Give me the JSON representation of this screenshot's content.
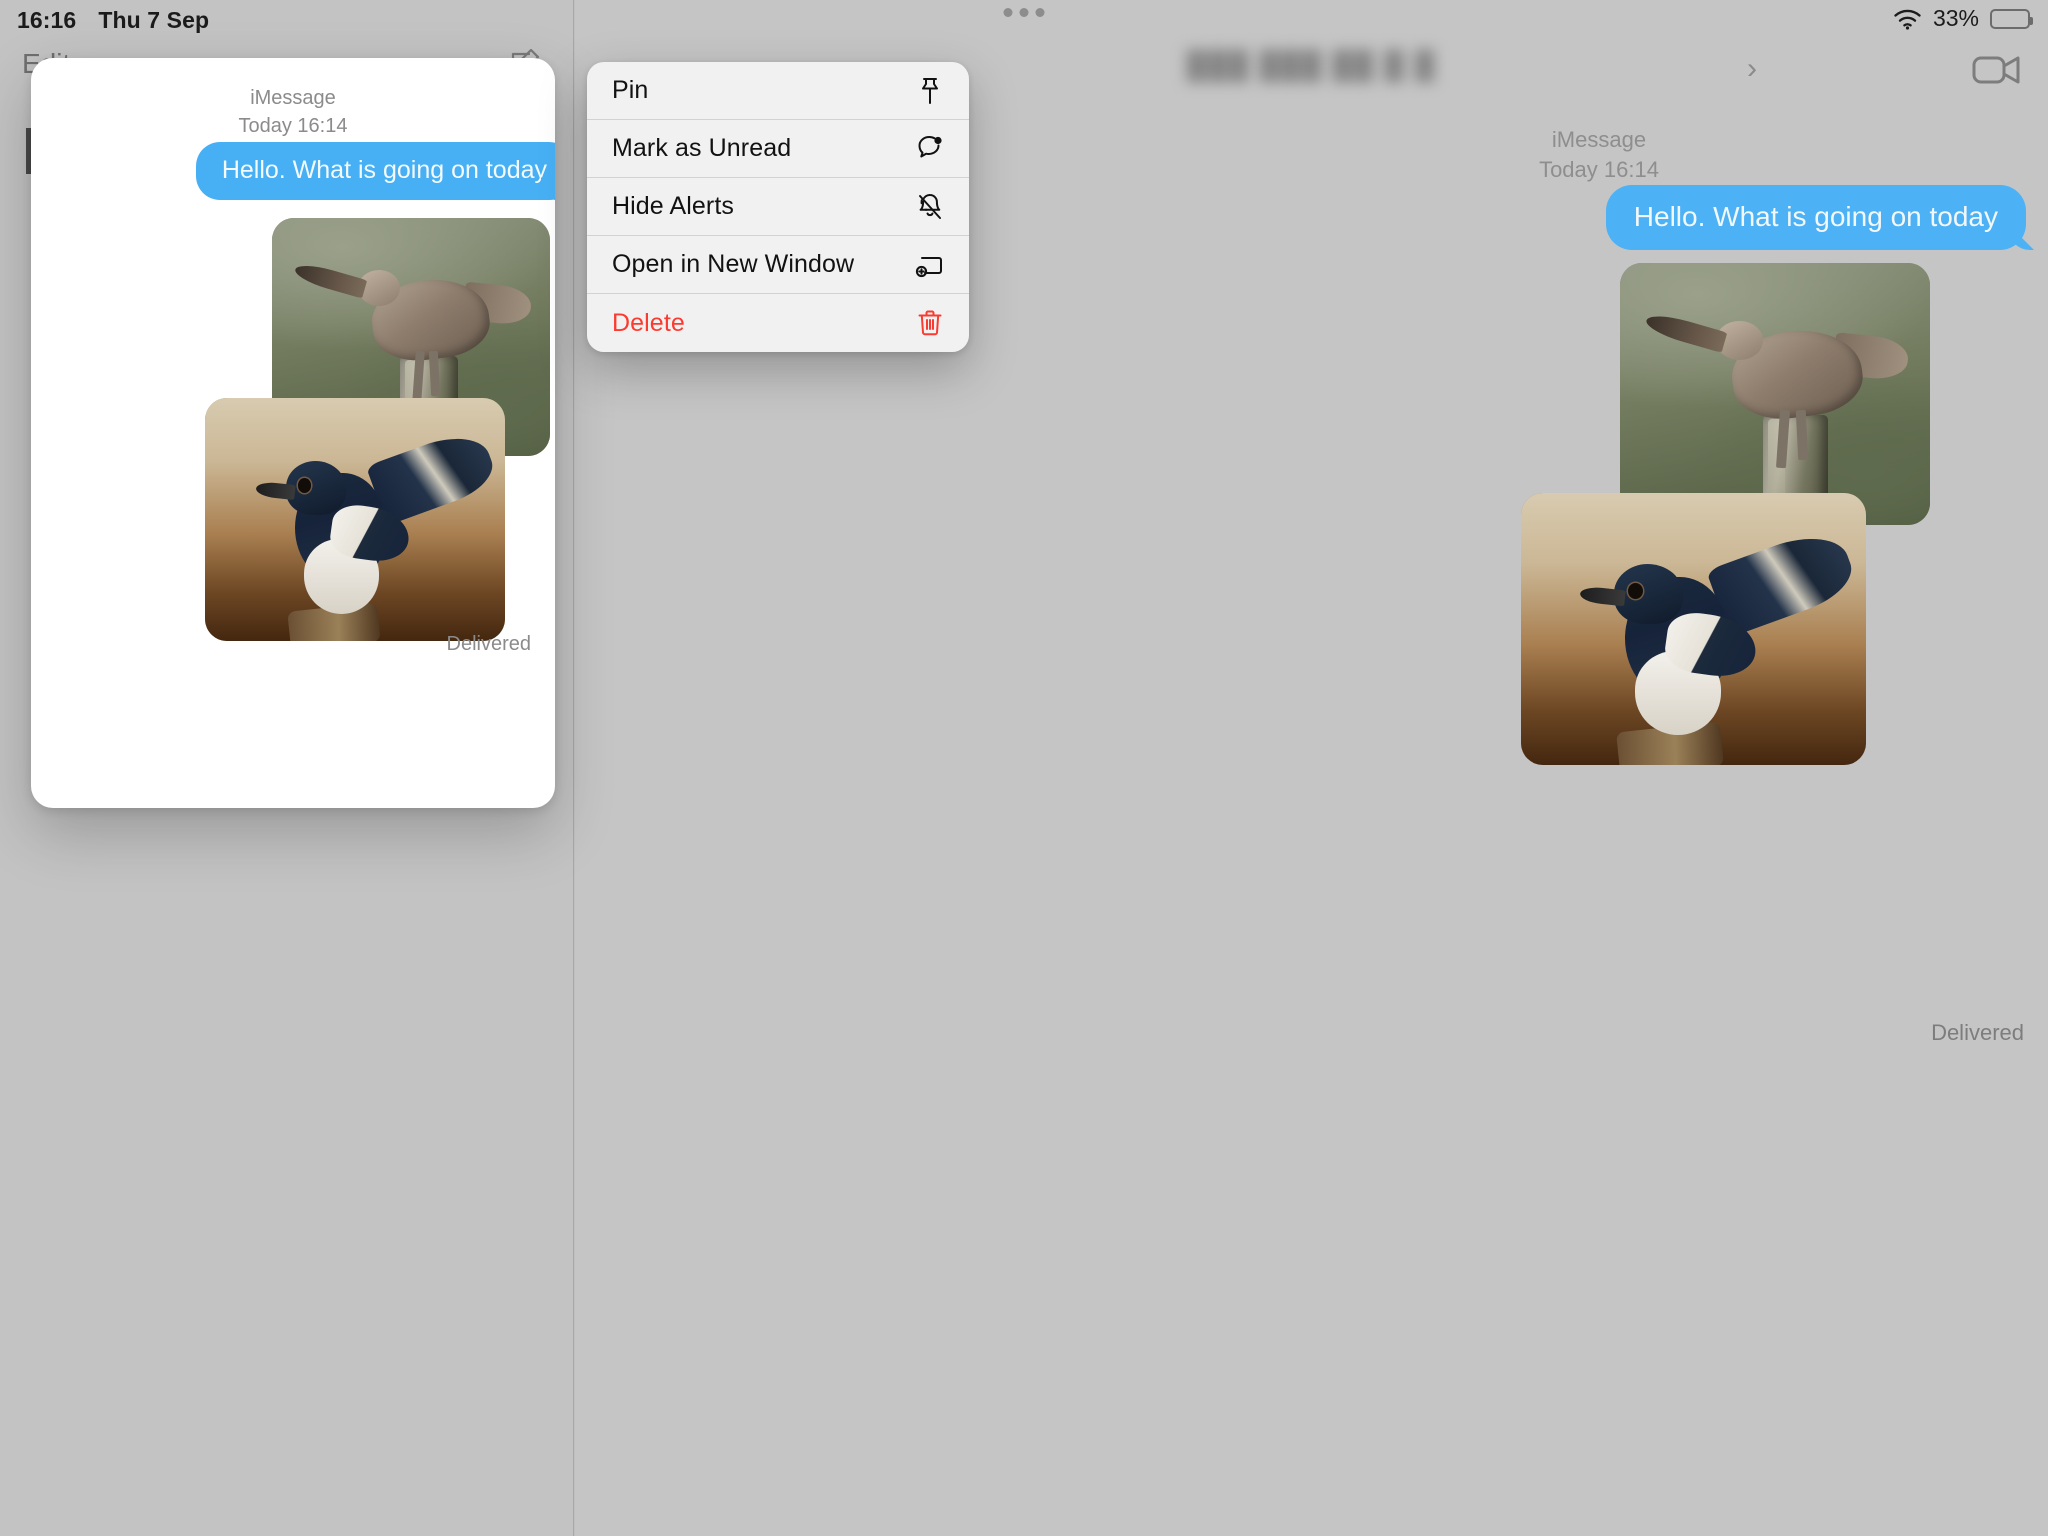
{
  "status_bar": {
    "time": "16:16",
    "date": "Thu 7 Sep",
    "wifi_icon": "wifi-icon",
    "battery_percent": "33%",
    "battery_level": 33
  },
  "multitask_handle": {
    "icon": "multitasking-dots-icon",
    "dot_count": 3
  },
  "sidebar": {
    "edit_label": "Edit",
    "compose_icon": "compose-icon"
  },
  "conversation_header": {
    "contact_name": "",
    "contact_name_redacted": true,
    "chevron_icon": "chevron-right-icon",
    "facetime_icon": "video-camera-icon"
  },
  "thread": {
    "service_label": "iMessage",
    "timestamp": "Today 16:14",
    "message_text": "Hello. What is going on today",
    "delivery_status": "Delivered",
    "bubble_color": "#47b0f5",
    "attachments": [
      {
        "name": "curlew-photo",
        "alt": "Whimbrel perched on weathered wooden post against green field"
      },
      {
        "name": "robin-photo",
        "alt": "Oriental magpie robin perched on branch against warm tan background"
      }
    ]
  },
  "preview_card": {
    "service_label": "iMessage",
    "timestamp": "Today 16:14",
    "message_text": "Hello. What is going on today",
    "delivery_status": "Delivered"
  },
  "context_menu": {
    "items": [
      {
        "label": "Pin",
        "icon": "pin-icon",
        "destructive": false
      },
      {
        "label": "Mark as Unread",
        "icon": "unread-badge-icon",
        "destructive": false
      },
      {
        "label": "Hide Alerts",
        "icon": "bell-slash-icon",
        "destructive": false
      },
      {
        "label": "Open in New Window",
        "icon": "new-window-icon",
        "destructive": false
      },
      {
        "label": "Delete",
        "icon": "trash-icon",
        "destructive": true
      }
    ],
    "destructive_color": "#fc3b30"
  }
}
